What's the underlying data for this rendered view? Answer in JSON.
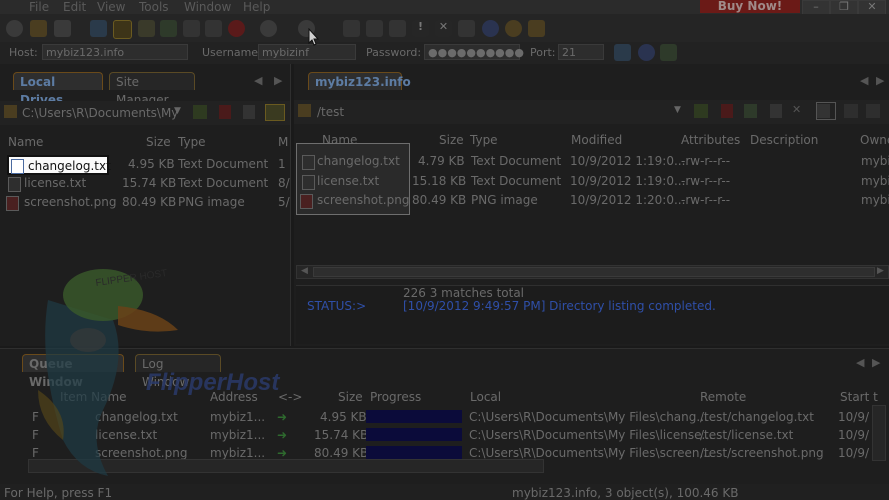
{
  "menu": {
    "file": "File",
    "edit": "Edit",
    "view": "View",
    "tools": "Tools",
    "window": "Window",
    "help": "Help",
    "buy_now": "Buy Now!"
  },
  "connection": {
    "host_label": "Host:",
    "host_value": "mybiz123.info",
    "username_label": "Username:",
    "username_value": "mybizinf",
    "password_label": "Password:",
    "password_value": "●●●●●●●●●●",
    "port_label": "Port:",
    "port_value": "21"
  },
  "local": {
    "tabs": [
      "Local Drives",
      "Site Manager"
    ],
    "path": "C:\\Users\\R\\Documents\\My",
    "columns": [
      "Name",
      "Size",
      "Type",
      "M"
    ],
    "files": [
      {
        "name": "changelog.txt",
        "size": "4.95 KB",
        "type": "Text Document",
        "m": "1"
      },
      {
        "name": "license.txt",
        "size": "15.74 KB",
        "type": "Text Document",
        "m": "8/"
      },
      {
        "name": "screenshot.png",
        "size": "80.49 KB",
        "type": "PNG image",
        "m": "5/"
      }
    ]
  },
  "remote": {
    "tab": "mybiz123.info",
    "path": "/test",
    "columns": [
      "Name",
      "Size",
      "Type",
      "Modified",
      "Attributes",
      "Description",
      "Owne"
    ],
    "files": [
      {
        "name": "changelog.txt",
        "size": "4.79 KB",
        "type": "Text Document",
        "modified": "10/9/2012 1:19:0...",
        "attributes": "-rw-r--r--",
        "owner": "mybi"
      },
      {
        "name": "license.txt",
        "size": "15.18 KB",
        "type": "Text Document",
        "modified": "10/9/2012 1:19:0...",
        "attributes": "-rw-r--r--",
        "owner": "mybi"
      },
      {
        "name": "screenshot.png",
        "size": "80.49 KB",
        "type": "PNG image",
        "modified": "10/9/2012 1:20:0...",
        "attributes": "-rw-r--r--",
        "owner": "mybi"
      }
    ],
    "log_line1": "226 3 matches total",
    "status_label": "STATUS:>",
    "status_msg": "[10/9/2012 9:49:57 PM] Directory listing completed."
  },
  "queue": {
    "tabs": [
      "Queue Window",
      "Log Window"
    ],
    "columns": [
      "Item Name",
      "Address",
      "<->",
      "Size",
      "Progress",
      "Local",
      "Remote",
      "Start t"
    ],
    "rows": [
      {
        "flag": "F",
        "name": "changelog.txt",
        "address": "mybiz1...",
        "size": "4.95 KB",
        "progress": 1.0,
        "local": "C:\\Users\\R\\Documents\\My Files\\chang...",
        "remote": "/test/changelog.txt",
        "start": "10/9/"
      },
      {
        "flag": "F",
        "name": "license.txt",
        "address": "mybiz1...",
        "size": "15.74 KB",
        "progress": 1.0,
        "local": "C:\\Users\\R\\Documents\\My Files\\license...",
        "remote": "/test/license.txt",
        "start": "10/9/"
      },
      {
        "flag": "F",
        "name": "screenshot.png",
        "address": "mybiz1...",
        "size": "80.49 KB",
        "progress": 1.0,
        "local": "C:\\Users\\R\\Documents\\My Files\\screen...",
        "remote": "/test/screenshot.png",
        "start": "10/9/"
      }
    ]
  },
  "watermark": {
    "brand": "FlipperHost",
    "cap_text": "FLIPPER HOST"
  },
  "statusbar": {
    "left": "For Help, press F1",
    "right": "mybiz123.info, 3 object(s), 100.46 KB"
  },
  "colors": {
    "accent_blue": "#5d7ca3",
    "status_blue": "#2f4fa8",
    "progress_blue": "#0b0b3a",
    "buy_red": "#6b1a17"
  }
}
